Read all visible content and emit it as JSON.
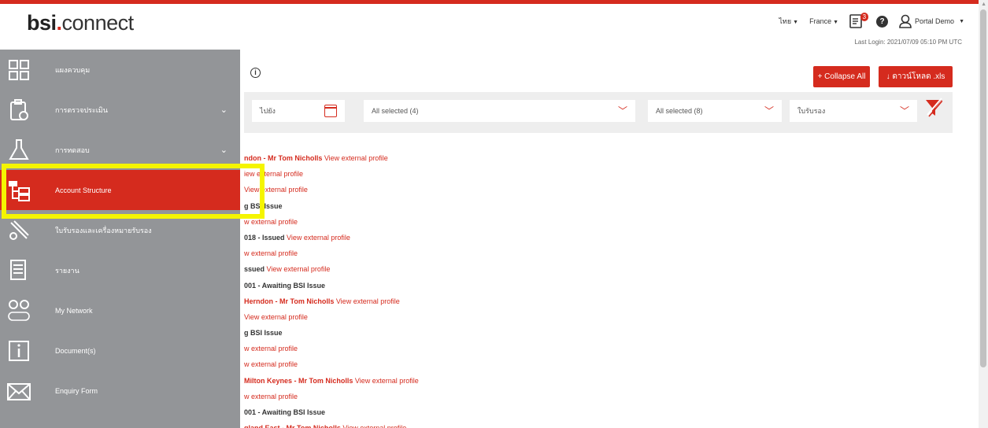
{
  "logo": {
    "brand": "bsi",
    "dot": ".",
    "product": "connect"
  },
  "header": {
    "language": "ไทย",
    "country": "France",
    "notification_count": "3",
    "help": "?",
    "user": "Portal Demo",
    "last_login": "Last Login: 2021/07/09 05:10 PM UTC"
  },
  "toolbar": {
    "info": "i",
    "collapse_label": "+ Collapse All",
    "download_label": "ดาวน์โหลด .xls"
  },
  "filters": {
    "date_to": "ไปยัง",
    "select1": "All selected (4)",
    "select2": "All selected (8)",
    "status": "ใบรับรอง"
  },
  "sidebar": {
    "items": [
      {
        "label": "แผงควบคุม",
        "icon": "dashboard-icon",
        "expandable": false
      },
      {
        "label": "การตรวจประเมิน",
        "icon": "clipboard-icon",
        "expandable": true
      },
      {
        "label": "การทดสอบ",
        "icon": "flask-icon",
        "expandable": true
      },
      {
        "label": "Account Structure",
        "icon": "hierarchy-icon",
        "expandable": false,
        "active": true
      },
      {
        "label": "ใบรับรองและเครื่องหมายรับรอง",
        "icon": "certificate-icon",
        "expandable": false
      },
      {
        "label": "รายงาน",
        "icon": "report-icon",
        "expandable": false
      },
      {
        "label": "My Network",
        "icon": "network-beta-icon",
        "expandable": false
      },
      {
        "label": "Document(s)",
        "icon": "document-info-icon",
        "expandable": false
      },
      {
        "label": "Enquiry Form",
        "icon": "envelope-icon",
        "expandable": false
      }
    ]
  },
  "rows": [
    [
      {
        "t": "ndon - Mr Tom Nicholls",
        "s": "bred"
      },
      {
        "t": "View external profile",
        "s": "lnk"
      }
    ],
    [
      {
        "t": "iew external profile",
        "s": "lnk"
      }
    ],
    [
      {
        "t": "View external profile",
        "s": "lnk"
      }
    ],
    [
      {
        "t": "g BSI Issue",
        "s": "b"
      }
    ],
    [
      {
        "t": "w external profile",
        "s": "lnk"
      }
    ],
    [
      {
        "t": "018 - Issued",
        "s": "b"
      },
      {
        "t": "View external profile",
        "s": "lnk"
      }
    ],
    [
      {
        "t": "w external profile",
        "s": "lnk"
      }
    ],
    [
      {
        "t": "ssued",
        "s": "b"
      },
      {
        "t": "View external profile",
        "s": "lnk"
      }
    ],
    [
      {
        "t": "001 - Awaiting BSI Issue",
        "s": "b"
      }
    ],
    [
      {
        "t": "Herndon - Mr Tom Nicholls",
        "s": "bred"
      },
      {
        "t": "View external profile",
        "s": "lnk"
      }
    ],
    [
      {
        "t": "View external profile",
        "s": "lnk"
      }
    ],
    [
      {
        "t": "g BSI Issue",
        "s": "b"
      }
    ],
    [
      {
        "t": "w external profile",
        "s": "lnk"
      }
    ],
    [
      {
        "t": "w external profile",
        "s": "lnk"
      }
    ],
    [
      {
        "t": "Milton Keynes - Mr Tom Nicholls",
        "s": "bred"
      },
      {
        "t": "View external profile",
        "s": "lnk"
      }
    ],
    [
      {
        "t": "w external profile",
        "s": "lnk"
      }
    ],
    [
      {
        "t": "001 - Awaiting BSI Issue",
        "s": "b"
      }
    ],
    [
      {
        "t": "gland East - Mr Tom Nicholls",
        "s": "bred"
      },
      {
        "t": "View external profile",
        "s": "lnk"
      }
    ]
  ],
  "colors": {
    "accent": "#d52b1e",
    "sidebar": "#939598",
    "highlight": "#f5f500"
  }
}
